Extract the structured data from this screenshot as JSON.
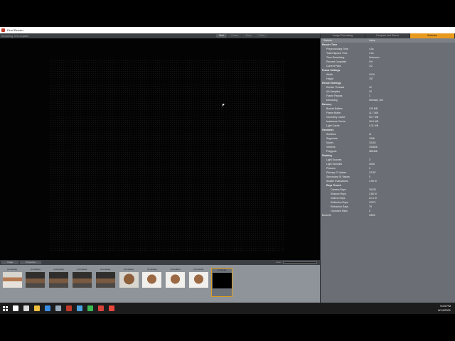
{
  "window": {
    "title": "Final Render"
  },
  "toolbar": {
    "status": "Rendering: 0% complete",
    "buttons": [
      "Start",
      "Pause",
      "Save",
      "Close"
    ]
  },
  "bottom_toolbar": {
    "tabs": [
      "Image",
      "Properties"
    ],
    "zoom_label": "Zoom"
  },
  "filmstrip": {
    "thumbnails": [
      {
        "caption": "[complete]",
        "style": "room"
      },
      {
        "caption": "[complete]",
        "style": "dark-room"
      },
      {
        "caption": "[complete]",
        "style": "dark-room"
      },
      {
        "caption": "[complete]",
        "style": "dark-room"
      },
      {
        "caption": "[complete]",
        "style": "dark-room"
      },
      {
        "caption": "[complete]",
        "style": "kitchen"
      },
      {
        "caption": "[complete]",
        "style": "kitchen-lt"
      },
      {
        "caption": "[complete]",
        "style": "kitchen-lt"
      },
      {
        "caption": "[complete]",
        "style": "kitchen-lt"
      },
      {
        "caption": "[running]",
        "style": "black"
      }
    ]
  },
  "right_panel": {
    "tabs": [
      {
        "label": "Image Processing",
        "active": false
      },
      {
        "label": "Compare and Stereo",
        "active": false
      },
      {
        "label": "Statistics",
        "active": true
      }
    ],
    "columns": [
      "Statistic",
      "Value"
    ],
    "rows": [
      {
        "k": "Render Time",
        "v": "",
        "lv": 0,
        "g": true
      },
      {
        "k": "Preprocessing Time",
        "v": "4.0s",
        "lv": 1
      },
      {
        "k": "Total Elapsed Time",
        "v": "4.0s",
        "lv": 1
      },
      {
        "k": "Time Remaining",
        "v": "Unknown",
        "lv": 1
      },
      {
        "k": "Percent Complete",
        "v": "0%",
        "lv": 1
      },
      {
        "k": "Current Pass",
        "v": "1/2",
        "lv": 1
      },
      {
        "k": "Frame Settings",
        "v": "",
        "lv": 0,
        "g": true
      },
      {
        "k": "Width",
        "v": "1019",
        "lv": 1
      },
      {
        "k": "Height",
        "v": "767",
        "lv": 1
      },
      {
        "k": "Render Settings",
        "v": "",
        "lv": 0,
        "g": true
      },
      {
        "k": "Render Threads",
        "v": "12",
        "lv": 1
      },
      {
        "k": "AA Samples",
        "v": "32",
        "lv": 1
      },
      {
        "k": "Frame Passes",
        "v": "1",
        "lv": 1
      },
      {
        "k": "Denoising",
        "v": "Intensity 100",
        "lv": 1
      },
      {
        "k": "Memory",
        "v": "",
        "lv": 0,
        "g": true
      },
      {
        "k": "Bucket Buffers",
        "v": "129 MB",
        "lv": 1
      },
      {
        "k": "Frame Buffer",
        "v": "11.7 MB",
        "lv": 1
      },
      {
        "k": "Geometry Cache",
        "v": "90.7 MB",
        "lv": 1
      },
      {
        "k": "Irradiance Cache",
        "v": "16.9 MB",
        "lv": 1
      },
      {
        "k": "Light Cache",
        "v": "0.31 MB",
        "lv": 1
      },
      {
        "k": "Geometry",
        "v": "",
        "lv": 0,
        "g": true
      },
      {
        "k": "Surfaces",
        "v": "11",
        "lv": 1
      },
      {
        "k": "Segments",
        "v": "1396",
        "lv": 1
      },
      {
        "k": "Nodes",
        "v": "10118",
        "lv": 1
      },
      {
        "k": "Vertices",
        "v": "344846",
        "lv": 1
      },
      {
        "k": "Polygons",
        "v": "389466",
        "lv": 1
      },
      {
        "k": "Shading",
        "v": "",
        "lv": 0,
        "g": true
      },
      {
        "k": "Light Sources",
        "v": "3",
        "lv": 1
      },
      {
        "k": "Light Samples",
        "v": "3046",
        "lv": 1
      },
      {
        "k": "Photons",
        "v": "0",
        "lv": 1
      },
      {
        "k": "Primary GI Values",
        "v": "12767",
        "lv": 1
      },
      {
        "k": "Secondary GI Values",
        "v": "0",
        "lv": 1
      },
      {
        "k": "Shader Evaluations",
        "v": "4.95 M",
        "lv": 1
      },
      {
        "k": "Rays Traced",
        "v": "",
        "lv": 1,
        "g": true
      },
      {
        "k": "Camera Rays",
        "v": "29433",
        "lv": 2
      },
      {
        "k": "Shadow Rays",
        "v": "2.66 M",
        "lv": 2
      },
      {
        "k": "Indirect Rays",
        "v": "21.0 M",
        "lv": 2
      },
      {
        "k": "Reflection Rays",
        "v": "12071",
        "lv": 2
      },
      {
        "k": "Refraction Rays",
        "v": "79",
        "lv": 2
      },
      {
        "k": "Occluded Rays",
        "v": "0",
        "lv": 2
      },
      {
        "k": "Buckets",
        "v": "0/800",
        "lv": 0
      }
    ]
  },
  "taskbar": {
    "icons": [
      {
        "name": "search-icon",
        "color": "#ffffff"
      },
      {
        "name": "task-view-icon",
        "color": "#dddddd"
      },
      {
        "name": "file-explorer-icon",
        "color": "#f0c040"
      },
      {
        "name": "mail-icon",
        "color": "#3a8ee6"
      },
      {
        "name": "notepad-icon",
        "color": "#9ab"
      },
      {
        "name": "render-app-icon",
        "color": "#c23a2a"
      },
      {
        "name": "edge-icon",
        "color": "#4aa3df"
      },
      {
        "name": "chrome-icon",
        "color": "#3cba54"
      },
      {
        "name": "app-icon-red",
        "color": "#d9423a"
      },
      {
        "name": "app-icon-chrome2",
        "color": "#e8453c"
      }
    ],
    "time": "9:23 PM",
    "date": "8/14/2021"
  }
}
